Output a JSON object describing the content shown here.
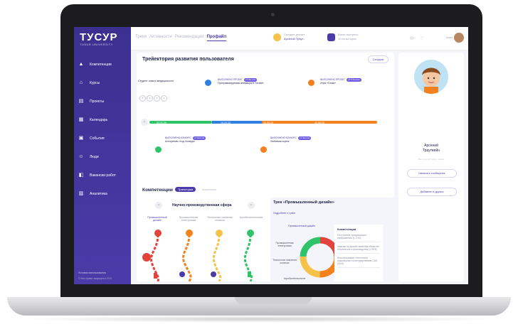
{
  "colors": {
    "accent": "#4a3ba8",
    "blue": "#2f7fe0",
    "orange": "#f3811e",
    "green": "#2fc46a",
    "red": "#e2433c",
    "yellow": "#f6c34a"
  },
  "sidebar": {
    "logo": "ТУСУР",
    "logo_sub": "TUSUR UNIVERSITY",
    "items": [
      {
        "label": "Компетенции",
        "icon": "rocket-icon"
      },
      {
        "label": "Курсы",
        "icon": "building-icon"
      },
      {
        "label": "Проекты",
        "icon": "document-icon"
      },
      {
        "label": "Календарь",
        "icon": "calendar-icon"
      },
      {
        "label": "События",
        "icon": "bookmark-icon"
      },
      {
        "label": "Люди",
        "icon": "people-icon"
      },
      {
        "label": "Вакансии работ",
        "icon": "id-icon"
      },
      {
        "label": "Аналитика",
        "icon": "chart-icon"
      }
    ],
    "footer": "Условия использования",
    "footer2": "© Все права защищены 2021"
  },
  "topbar": {
    "tabs": [
      "Треки",
      "Активности",
      "Рекомендации",
      "Профайл"
    ],
    "current_label": "Сегодня делает",
    "current_value": "Арсений Траут...",
    "progress_label": "Всего постреко",
    "progress_value": "10 из истории",
    "user": "Алек"
  },
  "main": {
    "title": "Трейектория развития пользователя",
    "today_button": "Сегодня",
    "events": [
      {
        "label": "Студент нового медицинского",
        "title": ""
      },
      {
        "label": "ВЫПОЛНЕНО ПРОЕКТ",
        "badge": "+8 баллов",
        "title": "Программируемая анимация в Scratch"
      },
      {
        "label": "ВЫПОЛНЕНО ПРОЕКТ",
        "badge": "+8.6 баллов",
        "title": "Игра «Гонки»"
      },
      {
        "label": "ВЫПОЛНЕНО КОНКУРС",
        "badge": "+3 баллов",
        "title": "Алгоритмы. Код. Конкурс"
      },
      {
        "label": "ВЫПОЛНЕНО КОНКУРС",
        "badge": "+2 баллов",
        "title": "Любимая сцена"
      }
    ],
    "dates": [
      "02.01.20",
      "15.03.20",
      "10.05.20",
      "22.08.20"
    ],
    "competences_title": "Компетенции",
    "comp_tab_active": "Траектория",
    "comp_tab_other": "Аналитика",
    "sphere": "Научно-производственная сфера",
    "columns": [
      "Промышленный дизайн",
      "Промышленная электроника",
      "Технологии освоения космоса",
      "Агробиотехнологии"
    ],
    "track_title": "Трек «Промышленный дизайн»",
    "track_link": "Подробнее о треке",
    "track_labels": [
      "Промышленный дизайн",
      "Промышленная электроника",
      "Технологии освоения космоса",
      "Агробиотехнологии"
    ],
    "competencies_box": {
      "title": "Компетенции",
      "items": [
        "Построение графического изображения (1,7/12)",
        "Навыки по дизайн-макетам объектов технического производства (1,9/15)",
        "Использование технологии инжинерного конструирования САD (3/10)"
      ]
    }
  },
  "profile": {
    "name_first": "Арсений",
    "name_last": "Траутвейн",
    "sub": "Был в сети 5 минут назад",
    "message_button": "Написать сообщение",
    "friend_button": "Добавить в друзья"
  }
}
